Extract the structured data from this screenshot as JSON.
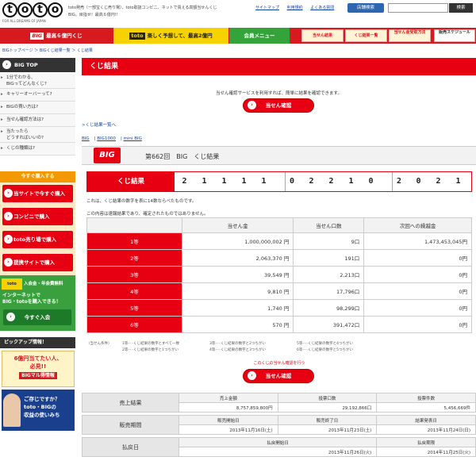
{
  "header": {
    "logo_letters": [
      "t",
      "o",
      "t",
      "o"
    ],
    "logo_sub": "FOR ALL DREAMS OF JAPAN",
    "description": "toto発売（一部宝くじ売り場）、toto取扱コンビニ、ネットで買える高額当せんくじBIG。目指せ！最高６億円!!",
    "topnav": [
      "サイトマップ",
      "利用規約",
      "よくある質問"
    ],
    "store_button": "店舗検索",
    "search_button": "検索"
  },
  "navbar": {
    "big_badge": "BIG",
    "big_text": "最高６億円くじ",
    "toto_badge": "toto",
    "toto_text": "楽しく予想して、最高2億円",
    "member": "会員メニュー",
    "small": [
      "当せん結果",
      "くじ結果一覧",
      "当せん金受取方法",
      "販売スケジュール"
    ]
  },
  "breadcrumb": "BIGトップページ ＞ BIGくじ結果一覧 ＞ くじ結果",
  "sidebar": {
    "top": "BIG TOP",
    "items": [
      {
        "label_1": "1分でわかる、",
        "label_2": "BIGってどんなくじ?"
      },
      {
        "label_1": "キャリーオーバーって?",
        "label_2": ""
      },
      {
        "label_1": "BIGの買い方は?",
        "label_2": ""
      },
      {
        "label_1": "当せん確認方法は?",
        "label_2": ""
      },
      {
        "label_1": "当たったら",
        "label_2": "どうすればいいの?"
      },
      {
        "label_1": "くじの種類は?",
        "label_2": ""
      }
    ],
    "buy_head": "今すぐ購入する",
    "buy_buttons": [
      "当サイトで今すぐ購入",
      "コンビニで購入",
      "toto売り場で購入",
      "提携サイトで購入"
    ],
    "internet_logo": "toto",
    "internet_t1_1": "入会金・年会費無料",
    "internet_t2_1": "インターネットで",
    "internet_t2_2": "BIG・totoを購入できる！",
    "internet_btn": "今すぐ入会",
    "pickup_head": "ピックアップ情報！",
    "banner1_1": "6億円当てたい人、",
    "banner1_2": "必見!!",
    "banner1_sub": "BIGマル得情報",
    "banner2_1": "ご存じですか？",
    "banner2_2": "toto・BIGの",
    "banner2_3": "収益の使いみち"
  },
  "main": {
    "title": "くじ結果",
    "service_note": "当せん確認サービスを利用すれば、簡単に結果を確認できます。",
    "confirm_button": "当せん確認",
    "results_list_link": "くじ結果一覧へ",
    "sub_links": [
      "BIG",
      "BIG1000",
      "mini BIG"
    ],
    "big_badge": "BIG",
    "round_title": "第662回　BIG　くじ結果",
    "result_label": "くじ結果",
    "digits": [
      "2",
      "1",
      "1",
      "1",
      "1",
      "0",
      "2",
      "2",
      "1",
      "0",
      "2",
      "0",
      "2",
      "1"
    ],
    "note1": "これは、くじ結果の数字を表に14数ならべたものです。",
    "note2": "この内容は速報結果であり、確定されたものではありません。",
    "table_headers": [
      "",
      "当せん金",
      "当せん口数",
      "次回への繰越金"
    ],
    "prize_rows": [
      {
        "rank": "1等",
        "amount": "1,000,000,002 円",
        "count": "9口",
        "carry": "1,473,453,045円"
      },
      {
        "rank": "2等",
        "amount": "2,063,370 円",
        "count": "191口",
        "carry": "0円"
      },
      {
        "rank": "3等",
        "amount": "39,549 円",
        "count": "2,213口",
        "carry": "0円"
      },
      {
        "rank": "4等",
        "amount": "9,810 円",
        "count": "17,796口",
        "carry": "0円"
      },
      {
        "rank": "5等",
        "amount": "1,740 円",
        "count": "98,299口",
        "carry": "0円"
      },
      {
        "rank": "6等",
        "amount": "570 円",
        "count": "391,472口",
        "carry": "0円"
      }
    ],
    "legend": {
      "title": "（当せん条件）",
      "c1_1": "1等･･･くじ結果の数字とすべて一致",
      "c1_2": "2等･･･くじ結果の数字と1つちがい",
      "c2_1": "3等･･･くじ結果の数字と2つちがい",
      "c2_2": "4等･･･くじ結果の数字と3つちがい",
      "c3_1": "5等･･･くじ結果の数字と4つちがい",
      "c3_2": "6等･･･くじ結果の数字と5つちがい"
    },
    "confirm_note": "このくじの当せん確認を行う",
    "confirm_button2": "当せん確認",
    "sales": {
      "sales_head": "売上結果",
      "sales_sub": [
        "売上金額",
        "投票口数",
        "投票件数"
      ],
      "sales_val": [
        "8,757,859,800円",
        "29,192,866口",
        "5,456,669件"
      ],
      "period_head": "販売期間",
      "period_sub": [
        "販売開始日",
        "販売終了日",
        "結果発表日"
      ],
      "period_val": [
        "2013年11月16日(土)",
        "2013年11月23日(土)",
        "2013年11月24日(日)"
      ],
      "pay_head": "払戻日",
      "pay_sub": [
        "払戻開始日",
        "払戻期限"
      ],
      "pay_val": [
        "2013年11月26日(火)",
        "2014年11月25日(火)"
      ]
    }
  }
}
